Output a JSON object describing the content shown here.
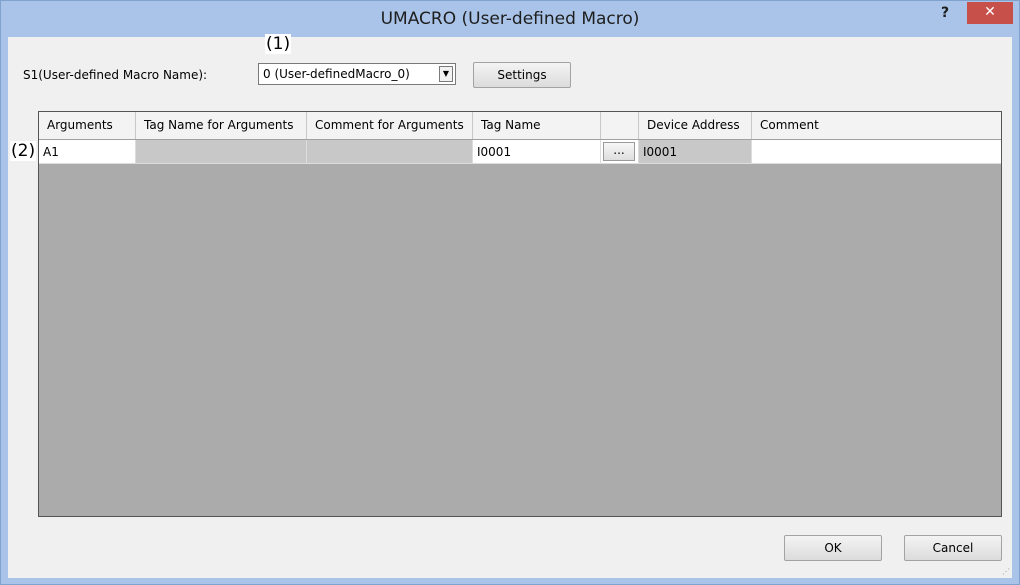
{
  "window": {
    "title": "UMACRO (User-defined Macro)",
    "help_label": "?",
    "close_label": "✕"
  },
  "s1": {
    "label": "S1(User-defined Macro Name):",
    "selected": "0 (User-definedMacro_0)",
    "settings_label": "Settings"
  },
  "annotations": {
    "one": "(1)",
    "two": "(2)"
  },
  "table": {
    "headers": [
      "Arguments",
      "Tag Name for Arguments",
      "Comment for Arguments",
      "Tag Name",
      "",
      "Device Address",
      "Comment"
    ],
    "rows": [
      {
        "argument": "A1",
        "tag_name_for_arguments": "",
        "comment_for_arguments": "",
        "tag_name": "I0001",
        "browse": "...",
        "device_address": "I0001",
        "comment": ""
      }
    ]
  },
  "footer": {
    "ok_label": "OK",
    "cancel_label": "Cancel"
  },
  "colors": {
    "close_button": "#c7504b",
    "grid_background": "#ababab",
    "disabled_cell": "#c8c8c8"
  },
  "icons": {
    "dropdown": "chevron-down-icon",
    "resize": "resize-grip-icon"
  }
}
